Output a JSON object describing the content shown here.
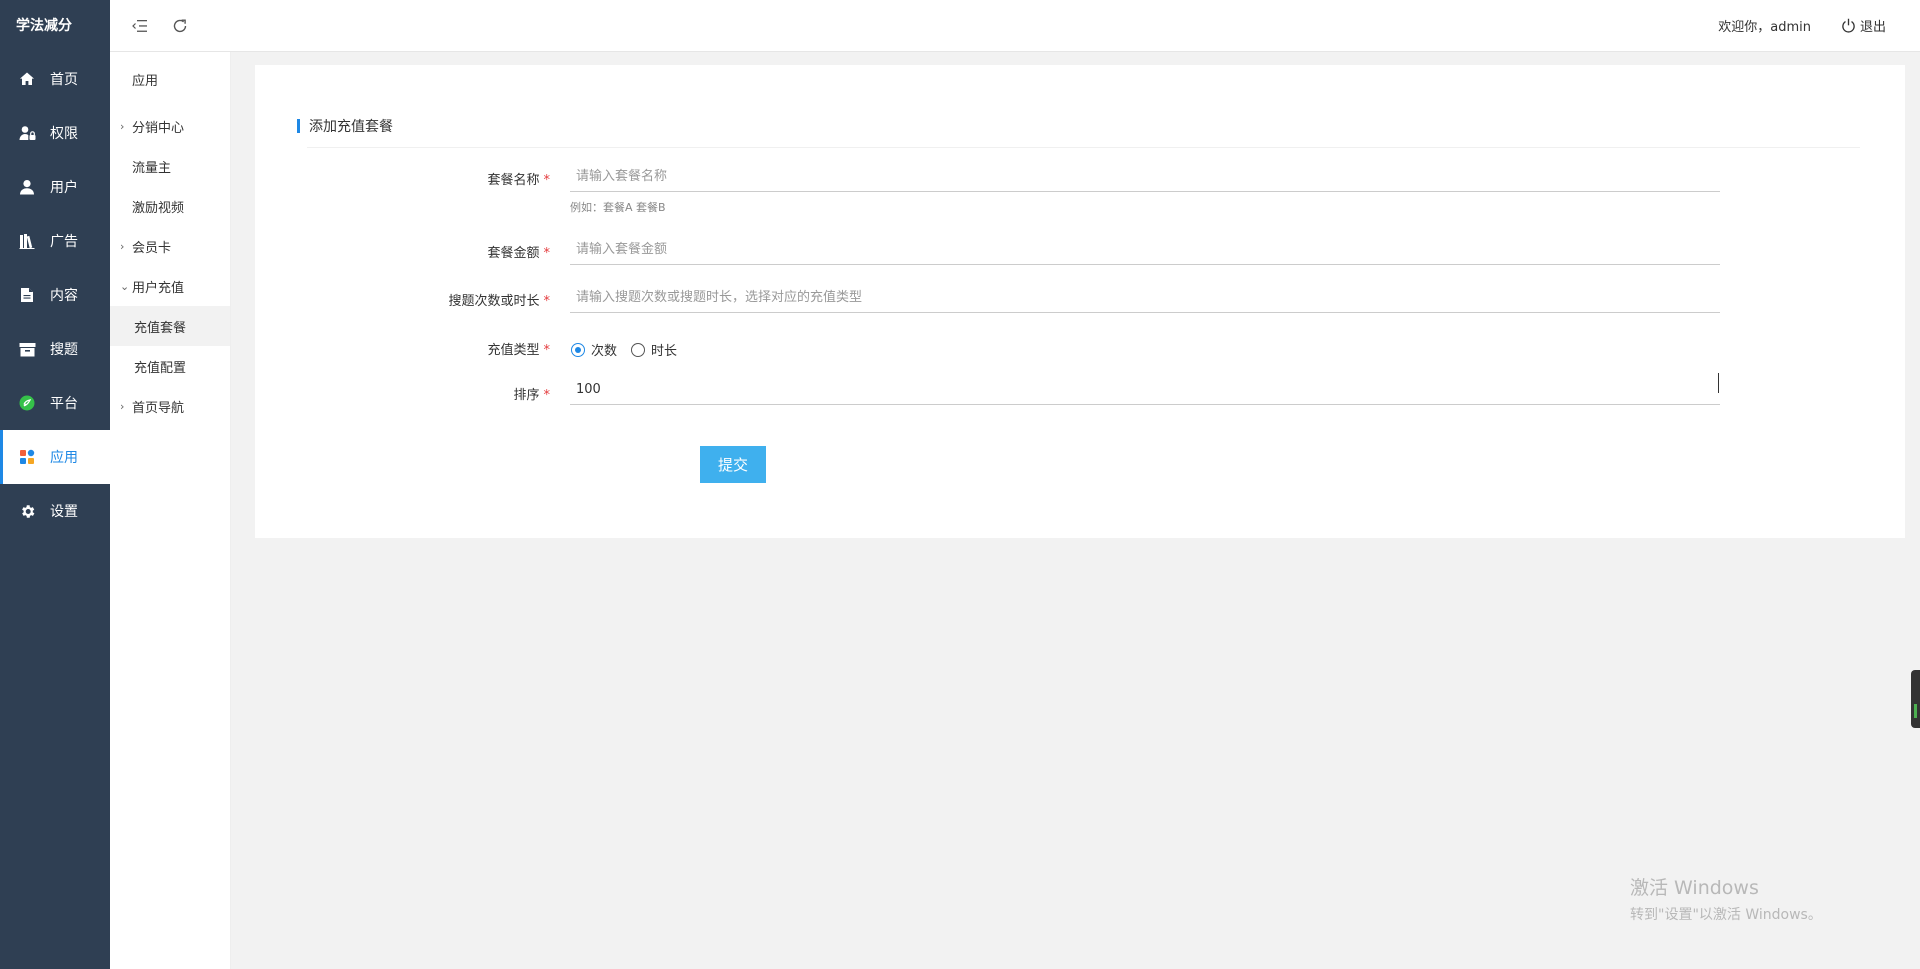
{
  "app": {
    "brand": "学法减分"
  },
  "sidebar": {
    "items": [
      {
        "label": "首页",
        "icon": "home-icon"
      },
      {
        "label": "权限",
        "icon": "user-lock-icon"
      },
      {
        "label": "用户",
        "icon": "user-icon"
      },
      {
        "label": "广告",
        "icon": "books-icon"
      },
      {
        "label": "内容",
        "icon": "document-icon"
      },
      {
        "label": "搜题",
        "icon": "archive-icon"
      },
      {
        "label": "平台",
        "icon": "platform-icon"
      },
      {
        "label": "应用",
        "icon": "apps-icon",
        "active": true
      },
      {
        "label": "设置",
        "icon": "gear-icon"
      }
    ]
  },
  "submenu": {
    "title": "应用",
    "items": [
      {
        "label": "分销中心",
        "chevron": "›"
      },
      {
        "label": "流量主"
      },
      {
        "label": "激励视频"
      },
      {
        "label": "会员卡",
        "chevron": "›"
      },
      {
        "label": "用户充值",
        "chevron": "⌄"
      },
      {
        "label": "充值套餐",
        "child": true,
        "selected": true
      },
      {
        "label": "充值配置",
        "child": true
      },
      {
        "label": "首页导航",
        "chevron": "›"
      }
    ]
  },
  "header": {
    "welcome": "欢迎你，admin",
    "logout": "退出"
  },
  "form": {
    "title": "添加充值套餐",
    "name_label": "套餐名称",
    "name_placeholder": "请输入套餐名称",
    "name_hint": "例如：套餐A 套餐B",
    "amount_label": "套餐金额",
    "amount_placeholder": "请输入套餐金额",
    "count_label": "搜题次数或时长",
    "count_placeholder": "请输入搜题次数或搜题时长，选择对应的充值类型",
    "type_label": "充值类型",
    "type_options": [
      "次数",
      "时长"
    ],
    "type_selected": "次数",
    "sort_label": "排序",
    "sort_value": "100",
    "required_mark": "*",
    "submit": "提交"
  },
  "watermark": {
    "line1": "激活 Windows",
    "line2": "转到\"设置\"以激活 Windows。"
  },
  "colors": {
    "sidebar_bg": "#2f3f53",
    "accent": "#1e88e5",
    "submit_bg": "#3fb0ee",
    "required": "#e4393c"
  }
}
